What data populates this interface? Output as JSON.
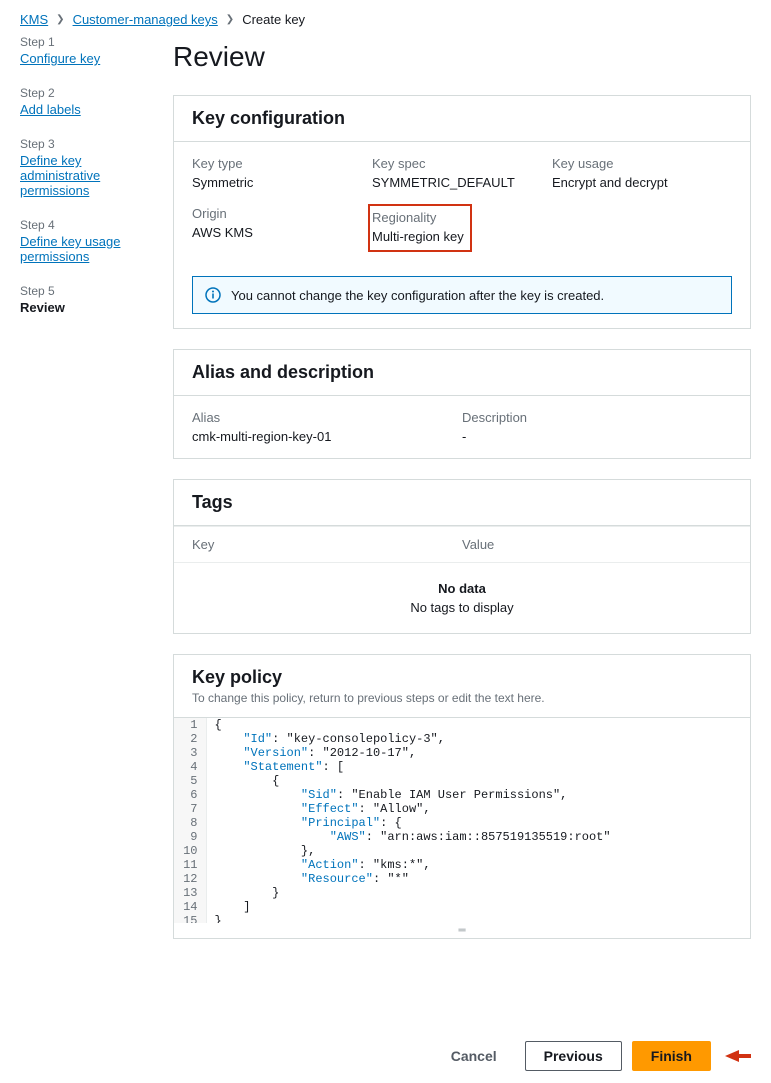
{
  "breadcrumb": {
    "kms": "KMS",
    "cmk": "Customer-managed keys",
    "current": "Create key"
  },
  "sidebar": {
    "steps": [
      {
        "label": "Step 1",
        "title": "Configure key"
      },
      {
        "label": "Step 2",
        "title": "Add labels"
      },
      {
        "label": "Step 3",
        "title": "Define key administrative permissions"
      },
      {
        "label": "Step 4",
        "title": "Define key usage permissions"
      },
      {
        "label": "Step 5",
        "title": "Review"
      }
    ]
  },
  "page_title": "Review",
  "key_config": {
    "heading": "Key configuration",
    "key_type_label": "Key type",
    "key_type_value": "Symmetric",
    "key_spec_label": "Key spec",
    "key_spec_value": "SYMMETRIC_DEFAULT",
    "key_usage_label": "Key usage",
    "key_usage_value": "Encrypt and decrypt",
    "origin_label": "Origin",
    "origin_value": "AWS KMS",
    "regionality_label": "Regionality",
    "regionality_value": "Multi-region key",
    "alert": "You cannot change the key configuration after the key is created."
  },
  "alias_desc": {
    "heading": "Alias and description",
    "alias_label": "Alias",
    "alias_value": "cmk-multi-region-key-01",
    "desc_label": "Description",
    "desc_value": "-"
  },
  "tags": {
    "heading": "Tags",
    "col_key": "Key",
    "col_value": "Value",
    "empty_title": "No data",
    "empty_sub": "No tags to display"
  },
  "policy": {
    "heading": "Key policy",
    "sub": "To change this policy, return to previous steps or edit the text here.",
    "json": {
      "Id": "key-consolepolicy-3",
      "Version": "2012-10-17",
      "Statement": [
        {
          "Sid": "Enable IAM User Permissions",
          "Effect": "Allow",
          "Principal": {
            "AWS": "arn:aws:iam::857519135519:root"
          },
          "Action": "kms:*",
          "Resource": "*"
        }
      ]
    }
  },
  "buttons": {
    "cancel": "Cancel",
    "previous": "Previous",
    "finish": "Finish"
  }
}
